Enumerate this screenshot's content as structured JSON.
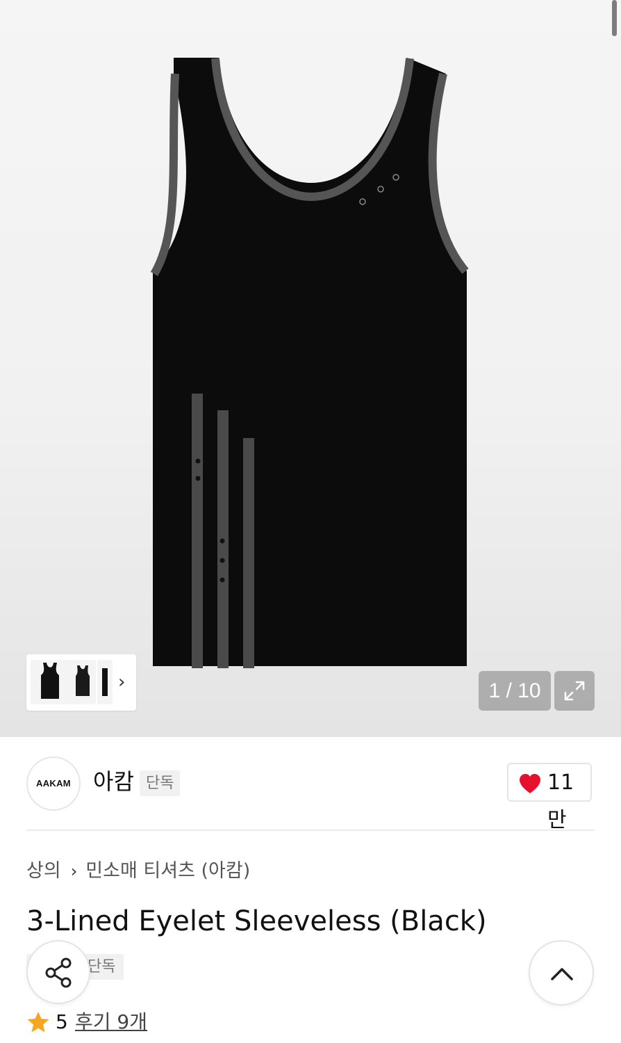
{
  "gallery": {
    "counter": "1 / 10",
    "image_alt": "3-Lined Eyelet Sleeveless (Black)",
    "more_icon": "chevron-right-icon",
    "expand_icon": "expand-icon"
  },
  "brand": {
    "logo_text": "AAKAM",
    "name": "아캄",
    "badge": "단독"
  },
  "like": {
    "icon": "heart-icon",
    "color": "#e8112d",
    "count": "11만"
  },
  "breadcrumb": {
    "category": "상의",
    "subcategory": "민소매 티셔츠 (아캄)"
  },
  "product": {
    "title": "3-Lined Eyelet Sleeveless (Black)",
    "tag": "단독"
  },
  "rating": {
    "icon": "star-icon",
    "star_color": "#f5a623",
    "score": "5",
    "reviews_label": "후기 9개"
  },
  "floating": {
    "share_icon": "share-icon",
    "top_icon": "chevron-up-icon"
  }
}
